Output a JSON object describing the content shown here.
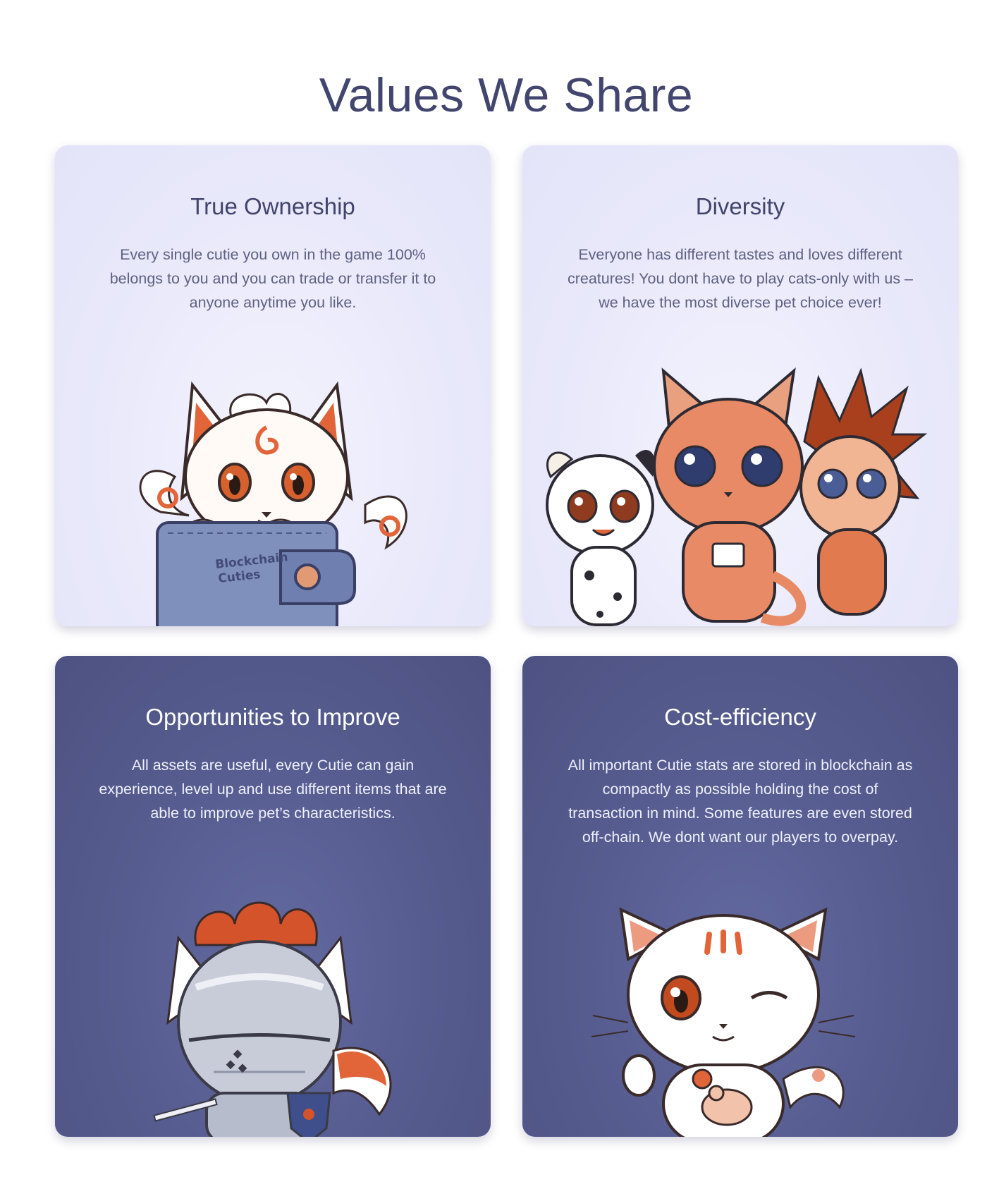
{
  "page": {
    "title": "Values We Share"
  },
  "cards": [
    {
      "title": "True Ownership",
      "text": "Every single cutie you own in the game 100% belongs to you and you can trade or transfer it to anyone anytime you like.",
      "theme": "light",
      "illustration": "fox-cutie-in-wallet",
      "wallet_label_line1": "Blockchain",
      "wallet_label_line2": "Cuties"
    },
    {
      "title": "Diversity",
      "text": "Everyone has different tastes and loves different creatures! You dont have to play cats-only with us – we have the most diverse pet choice ever!",
      "theme": "light",
      "illustration": "dalmatian-cat-hedgehog-group"
    },
    {
      "title": "Opportunities to Improve",
      "text": "All assets are useful, every Cutie can gain experience, level up and use different items that are able to improve pet’s characteristics.",
      "theme": "dark",
      "illustration": "knight-armored-fox"
    },
    {
      "title": "Cost-efficiency",
      "text": "All important Cutie stats are stored in blockchain as compactly as possible holding the cost of transaction in mind. Some features are even stored off-chain. We dont want our players to overpay.",
      "theme": "dark",
      "illustration": "winking-cat-with-mouse"
    }
  ],
  "colors": {
    "title": "#42456e",
    "light_card_bg": "#e9e9fb",
    "dark_card_bg": "#565c8f",
    "accent_orange": "#e2653a"
  }
}
